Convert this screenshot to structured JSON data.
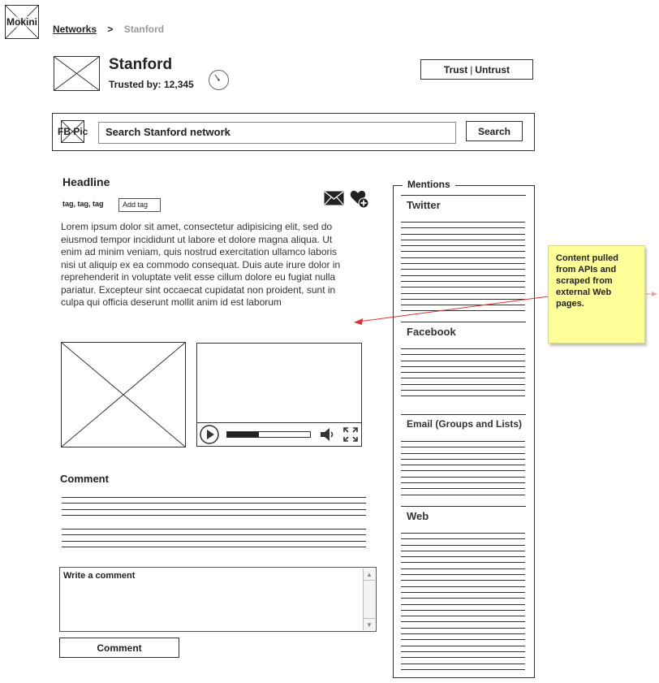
{
  "logo": {
    "label": "Mokini"
  },
  "breadcrumb": {
    "link": "Networks",
    "separator": ">",
    "current": "Stanford"
  },
  "network": {
    "title": "Stanford",
    "trusted_by": "Trusted by: 12,345"
  },
  "trust_button": {
    "trust": "Trust",
    "separator": "|",
    "untrust": "Untrust"
  },
  "search": {
    "pic_label": "FB Pic",
    "placeholder": "Search Stanford network",
    "button": "Search"
  },
  "post": {
    "headline": "Headline",
    "tags": "tag, tag, tag",
    "add_tag_label": "Add tag",
    "body": "Lorem ipsum dolor sit amet, consectetur adipisicing elit, sed do eiusmod tempor incididunt ut labore et dolore magna aliqua. Ut enim ad minim veniam, quis nostrud exercitation ullamco laboris nisi ut aliquip ex ea commodo consequat. Duis aute irure dolor in reprehenderit in voluptate velit esse cillum dolore eu fugiat nulla pariatur. Excepteur sint occaecat cupidatat non proident, sunt in culpa qui officia deserunt mollit anim id est laborum",
    "icons": [
      "envelope-icon",
      "heart-plus-icon"
    ]
  },
  "video": {
    "progress": 0.38,
    "icons": [
      "play-icon",
      "volume-icon",
      "fullscreen-icon"
    ]
  },
  "comments": {
    "heading": "Comment",
    "textarea_value": "Write a comment",
    "submit_label": "Comment"
  },
  "mentions": {
    "title": "Mentions",
    "sections": [
      {
        "title": "Twitter"
      },
      {
        "title": "Facebook"
      },
      {
        "title": "Email (Groups and Lists)"
      },
      {
        "title": "Web"
      }
    ]
  },
  "annotation": {
    "text": "Content pulled from APIs and scraped from external Web pages.",
    "colors": {
      "note": "#ffff99",
      "arrow": "#e03030"
    }
  }
}
